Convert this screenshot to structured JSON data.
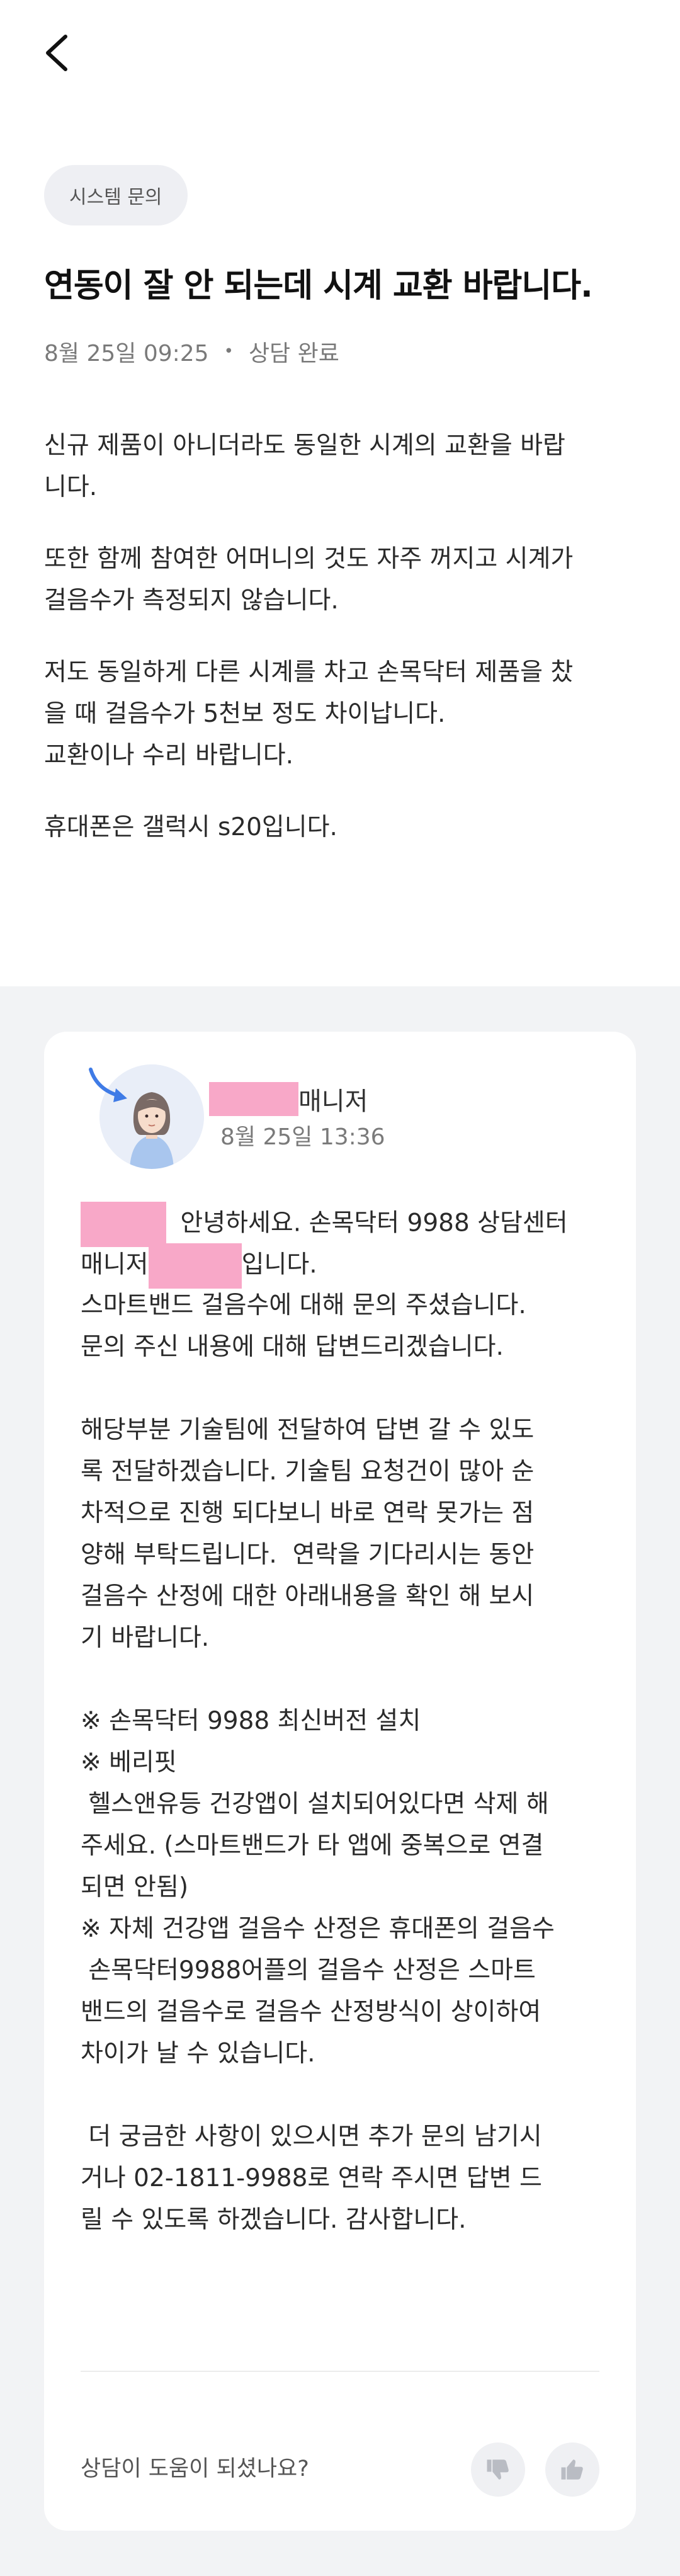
{
  "header": {
    "back_icon": "chevron-left-icon"
  },
  "inquiry": {
    "category": "시스템 문의",
    "title": "연동이 잘 안 되는데 시계 교환 바랍니다.",
    "date": "8월 25일 09:25",
    "status": "상담 완료",
    "body": [
      "신규 제품이 아니더라도 동일한 시계의 교환을 바랍\n니다.",
      "또한 함께 참여한 어머니의 것도 자주 꺼지고 시계가\n걸음수가 측정되지 않습니다.",
      "저도 동일하게 다른 시계를 차고 손목닥터 제품을 찼\n을 때 걸음수가 5천보 정도 차이납니다.\n교환이나 수리 바랍니다.",
      "휴대폰은 갤럭시 s20입니다."
    ]
  },
  "answer": {
    "manager_suffix": "매니저",
    "date": "8월 25일 13:36",
    "line1_rest": " 안녕하세요. 손목닥터 9988 상담센터",
    "line2_prefix": "매니저",
    "line2_suffix": "입니다.",
    "lines_a": [
      "스마트밴드 걸음수에 대해 문의 주셨습니다.",
      "문의 주신 내용에 대해 답변드리겠습니다."
    ],
    "lines_b": [
      "해당부분 기술팀에 전달하여 답변 갈 수 있도",
      "록 전달하겠습니다. 기술팀 요청건이 많아 순",
      "차적으로 진행 되다보니 바로 연락 못가는 점",
      "양해 부탁드립니다.  연락을 기다리시는 동안",
      "걸음수 산정에 대한 아래내용을 확인 해 보시",
      "기 바랍니다."
    ],
    "lines_c": [
      "※ 손목닥터 9988 최신버전 설치",
      "※ 베리핏",
      " 헬스앤유등 건강앱이 설치되어있다면 삭제 해",
      "주세요. (스마트밴드가 타 앱에 중복으로 연결",
      "되면 안됨)",
      "※ 자체 건강앱 걸음수 산정은 휴대폰의 걸음수",
      " 손목닥터9988어플의 걸음수 산정은 스마트",
      "밴드의 걸음수로 걸음수 산정방식이 상이하여",
      "차이가 날 수 있습니다."
    ],
    "lines_d": [
      " 더 궁금한 사항이 있으시면 추가 문의 남기시",
      "거나 02-1811-9988로 연락 주시면 답변 드",
      "릴 수 있도록 하겠습니다. 감사합니다."
    ]
  },
  "feedback": {
    "question": "상담이 도움이 되셨나요?",
    "down_icon": "thumbs-down-icon",
    "up_icon": "thumbs-up-icon"
  },
  "colors": {
    "mask": "#f8a8c8",
    "answer_background": "#f2f3f5",
    "tag_background": "#eeeff3"
  }
}
